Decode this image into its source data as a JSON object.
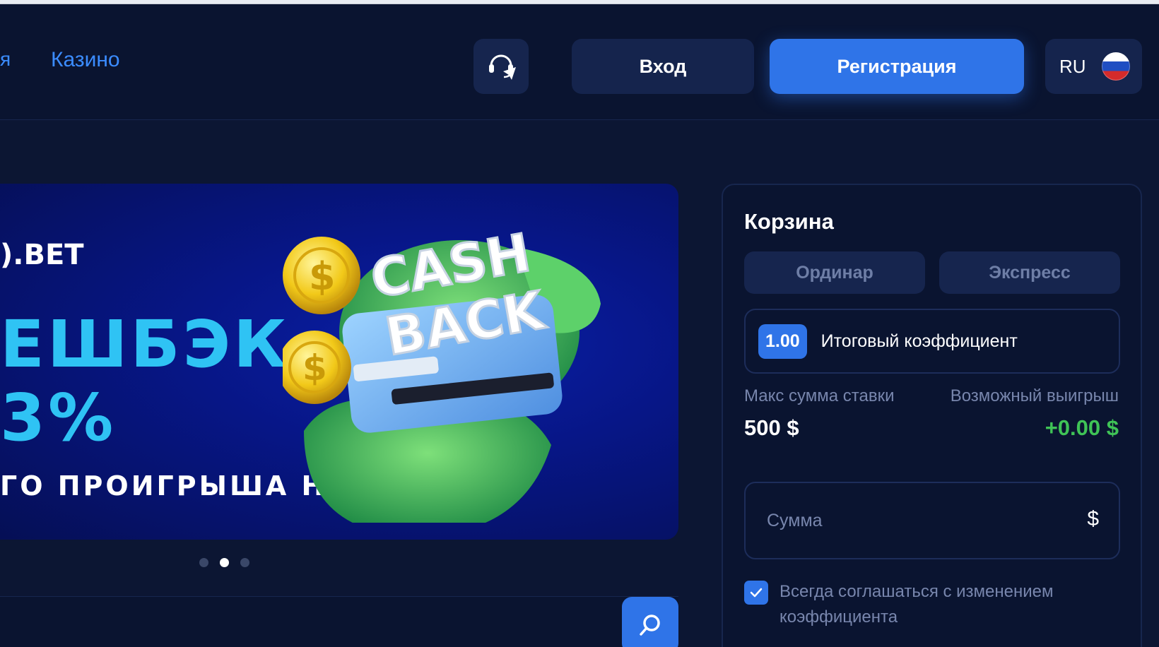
{
  "header": {
    "nav_partial": "я",
    "nav_casino": "Казино",
    "support_icon": "headset-telegram-icon",
    "login_label": "Вход",
    "register_label": "Регистрация",
    "language_code": "RU",
    "flag_icon": "russia-flag-icon"
  },
  "banner": {
    "brand": ").BET",
    "headline_line1": "ЕШБЭК",
    "headline_line2": "3%",
    "subline": "ГО ПРОИГРЫША НА БАЛАНС",
    "art_text_line1": "CASH",
    "art_text_line2": "BACK",
    "slides_total": 3,
    "active_slide": 2
  },
  "cart": {
    "title": "Корзина",
    "tabs": [
      {
        "label": "Ординар"
      },
      {
        "label": "Экспресс"
      }
    ],
    "coefficient_value": "1.00",
    "coefficient_label": "Итоговый коэффициент",
    "max_bet_label": "Макс сумма ставки",
    "possible_win_label": "Возможный выигрыш",
    "max_bet_value": "500 $",
    "possible_win_value": "+0.00 $",
    "amount_placeholder": "Сумма",
    "currency_symbol": "$",
    "agree_checked": true,
    "agree_text": "Всегда соглашаться с изменением коэффициента"
  },
  "colors": {
    "background": "#0c1633",
    "accent": "#2f74e8",
    "win_green": "#3fc356",
    "banner_cyan": "#2fc3f4"
  }
}
